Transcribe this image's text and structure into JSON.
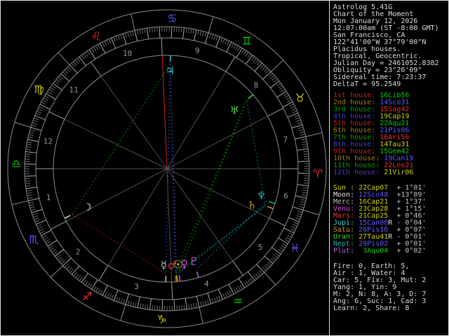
{
  "palette": {
    "text": "#dcdcdc",
    "speed": "#c4c4c4",
    "fire": "#ef2d2d",
    "earth": "#cece00",
    "air": "#00ce00",
    "water": "#5858ff",
    "h_fire": "#c22222",
    "h_earth": "#9c7c14",
    "h_air": "#00a000",
    "h_water": "#4040c8",
    "sun": "#dede00",
    "moon": "#e8e8e8",
    "merc": "#bdbdbd",
    "venu": "#de4ade",
    "mars": "#ee3030",
    "jupi": "#34cccc",
    "satu": "#cc9632",
    "uran": "#3ad83a",
    "nept": "#28aaaa",
    "plut": "#b468e0",
    "ring": "#8a8a8a",
    "tick_minor": "#6a6a6a",
    "tick_major": "#a8a8a8",
    "cusp_inner": "#4e4e4e",
    "cusp_ring": "#a0a0a0",
    "house_num": "#989898",
    "mc_line": "#d02020"
  },
  "header": {
    "lines": [
      "Astrolog 5.41G",
      "Chart of the Moment",
      "Mon January 12, 2026",
      "12:07:00am (ST -8:00 GMT)",
      "San Francisco, CA",
      "122°41'00\"W 37°79'00\"N",
      "Placidus houses.",
      "Tropical, Geocentric.",
      "Julian Day = 2461052.8382",
      "Obliquity = 23°26'09\"",
      "Sidereal time: 7:23:37",
      "DeltaT = 95.2549"
    ]
  },
  "houses": [
    {
      "label": "1st house: ",
      "value": "16Lib56",
      "label_color": "h_fire",
      "value_color": "air"
    },
    {
      "label": "2nd house: ",
      "value": "14Sco31",
      "label_color": "h_earth",
      "value_color": "water"
    },
    {
      "label": "3rd house: ",
      "value": "15Sag42",
      "label_color": "h_air",
      "value_color": "fire"
    },
    {
      "label": "4th house: ",
      "value": "19Cap19",
      "label_color": "h_water",
      "value_color": "earth"
    },
    {
      "label": "5th house: ",
      "value": "22Aqu21",
      "label_color": "h_fire",
      "value_color": "air"
    },
    {
      "label": "6th house: ",
      "value": "21Pis06",
      "label_color": "h_earth",
      "value_color": "water"
    },
    {
      "label": "7th house: ",
      "value": "16Ari56",
      "label_color": "h_air",
      "value_color": "fire"
    },
    {
      "label": "8th house: ",
      "value": "14Tau31",
      "label_color": "h_water",
      "value_color": "earth"
    },
    {
      "label": "9th house: ",
      "value": "15Gem42",
      "label_color": "h_fire",
      "value_color": "air"
    },
    {
      "label": "10th house: ",
      "value": "19Can19",
      "label_color": "h_earth",
      "value_color": "water"
    },
    {
      "label": "11th house: ",
      "value": "22Leo21",
      "label_color": "h_air",
      "value_color": "fire"
    },
    {
      "label": "12th house: ",
      "value": "21Vir06",
      "label_color": "h_water",
      "value_color": "earth"
    }
  ],
  "planets": [
    {
      "name": "Sun : ",
      "pos": "22Cap07",
      "retro": " ",
      "speed": "+ 1°01'",
      "color": "sun",
      "sign_color": "earth"
    },
    {
      "name": "Moon: ",
      "pos": "12Sco48",
      "retro": " ",
      "speed": "+13°09'",
      "color": "moon",
      "sign_color": "water"
    },
    {
      "name": "Merc: ",
      "pos": "16Cap21",
      "retro": " ",
      "speed": "+ 1°37'",
      "color": "merc",
      "sign_color": "earth"
    },
    {
      "name": "Venu: ",
      "pos": "23Cap28",
      "retro": " ",
      "speed": "+ 1°15'",
      "color": "venu",
      "sign_color": "earth"
    },
    {
      "name": "Mars: ",
      "pos": "21Cap25",
      "retro": " ",
      "speed": "+ 0°46'",
      "color": "mars",
      "sign_color": "earth"
    },
    {
      "name": "Jupi: ",
      "pos": "15Can08",
      "retro": "R",
      "speed": "- 0°04'",
      "color": "jupi",
      "sign_color": "water"
    },
    {
      "name": "Satu: ",
      "pos": "26Pis16",
      "retro": " ",
      "speed": "+ 0°07'",
      "color": "satu",
      "sign_color": "water"
    },
    {
      "name": "Uran: ",
      "pos": "27Tau41",
      "retro": "R",
      "speed": "- 0°01'",
      "color": "uran",
      "sign_color": "earth"
    },
    {
      "name": "Nept: ",
      "pos": "29Pis02",
      "retro": " ",
      "speed": "+ 0°01'",
      "color": "nept",
      "sign_color": "water"
    },
    {
      "name": "Plut: ",
      "pos": " 3Aqu04",
      "retro": " ",
      "speed": "+ 0°02'",
      "color": "plut",
      "sign_color": "air"
    }
  ],
  "element_tally": [
    "Fire: 0, Earth: 5,",
    "Air : 1, Water: 4",
    "Car: 5, Fix: 3, Mut: 2",
    "Yang: 1, Yin: 9",
    "M: 2, N: 8, A: 3, D: 7",
    "Ang: 6, Suc: 1, Cad: 3",
    "Learn: 2, Share: 8"
  ],
  "wheel": {
    "asc": 196.93,
    "signs": [
      {
        "name": "Aries",
        "glyph": "♈",
        "element": "fire"
      },
      {
        "name": "Taurus",
        "glyph": "♉",
        "element": "earth"
      },
      {
        "name": "Gemini",
        "glyph": "♊",
        "element": "air"
      },
      {
        "name": "Cancer",
        "glyph": "♋",
        "element": "water"
      },
      {
        "name": "Leo",
        "glyph": "♌",
        "element": "fire"
      },
      {
        "name": "Virgo",
        "glyph": "♍",
        "element": "earth"
      },
      {
        "name": "Libra",
        "glyph": "♎",
        "element": "air"
      },
      {
        "name": "Scorpio",
        "glyph": "♏",
        "element": "water"
      },
      {
        "name": "Sagittarius",
        "glyph": "♐",
        "element": "fire"
      },
      {
        "name": "Capricorn",
        "glyph": "♑",
        "element": "earth"
      },
      {
        "name": "Aquarius",
        "glyph": "♒",
        "element": "air"
      },
      {
        "name": "Pisces",
        "glyph": "♓",
        "element": "water"
      }
    ],
    "house_cusps": [
      196.93,
      224.52,
      255.7,
      289.32,
      322.35,
      351.1,
      16.93,
      44.52,
      75.7,
      109.32,
      142.35,
      171.1
    ],
    "planets": [
      {
        "name": "sun",
        "glyph": "☉",
        "deg": 292.12,
        "ddeg": 293.6,
        "color": "sun"
      },
      {
        "name": "moon",
        "glyph": "☽",
        "deg": 222.8,
        "r": 126,
        "color": "moon"
      },
      {
        "name": "mercury",
        "glyph": "☿",
        "deg": 286.35,
        "ddeg": 285.0,
        "color": "merc"
      },
      {
        "name": "venus",
        "glyph": "♀",
        "deg": 293.47,
        "ddeg": 297.2,
        "color": "venu"
      },
      {
        "name": "mars",
        "glyph": "♂",
        "deg": 291.42,
        "ddeg": 290.0,
        "color": "mars"
      },
      {
        "name": "jupiter",
        "glyph": "♃",
        "deg": 105.13,
        "r": 140,
        "color": "jupi"
      },
      {
        "name": "saturn",
        "glyph": "♄",
        "deg": 356.27,
        "ddeg": 353.8,
        "r": 132,
        "color": "satu"
      },
      {
        "name": "uranus",
        "glyph": "♅",
        "deg": 57.68,
        "r": 127,
        "color": "uran"
      },
      {
        "name": "neptune",
        "glyph": "♆",
        "deg": 359.03,
        "ddeg": 361.0,
        "r": 140,
        "color": "nept"
      },
      {
        "name": "pluto",
        "glyph": "♇",
        "deg": 303.07,
        "r": 138,
        "color": "plut"
      }
    ],
    "aspects": [
      {
        "a": 5,
        "b": 0,
        "color": "#3452f0"
      },
      {
        "a": 5,
        "b": 4,
        "color": "#3452f0"
      },
      {
        "a": 5,
        "b": 2,
        "color": "#3452f0"
      },
      {
        "a": 7,
        "b": 3,
        "color": "#00b400"
      },
      {
        "a": 7,
        "b": 4,
        "color": "#00b400"
      },
      {
        "a": 1,
        "b": 5,
        "color": "#00b400"
      },
      {
        "a": 6,
        "b": 7,
        "color": "#00a8a8"
      },
      {
        "a": 3,
        "b": 6,
        "color": "#00a8a8"
      },
      {
        "a": 0,
        "b": 6,
        "color": "#00a8a8"
      },
      {
        "a": 8,
        "b": 9,
        "color": "#00a8a8"
      },
      {
        "a": 1,
        "b": 2,
        "color": "#d42020"
      }
    ]
  }
}
